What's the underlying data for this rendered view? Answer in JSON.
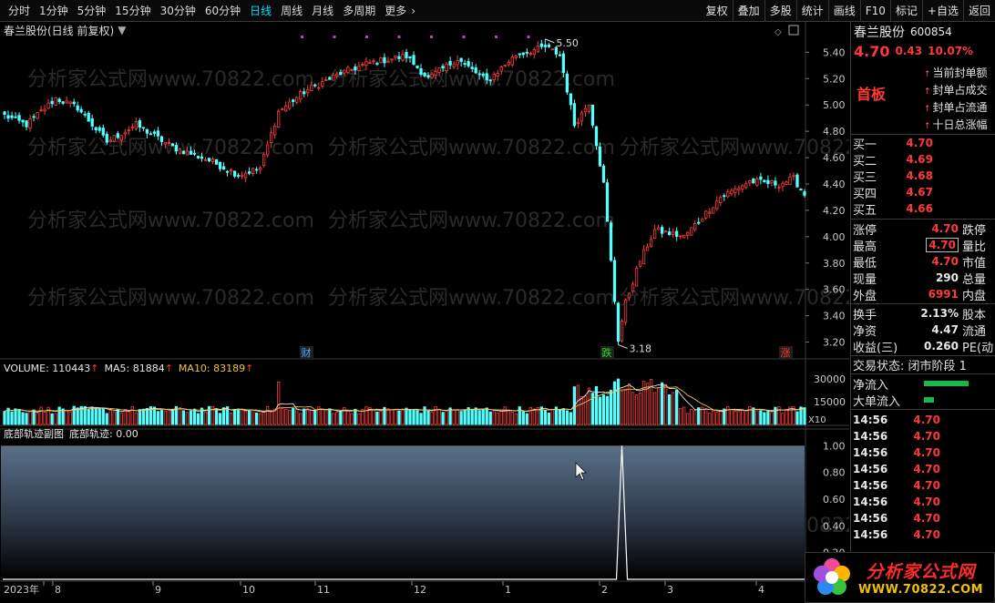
{
  "toolbar": {
    "periods": [
      "分时",
      "1分钟",
      "5分钟",
      "15分钟",
      "30分钟",
      "60分钟",
      "日线",
      "周线",
      "月线",
      "多周期",
      "更多"
    ],
    "active_period": "日线",
    "buttons": [
      "复权",
      "叠加",
      "多股",
      "统计",
      "画线",
      "F10",
      "标记",
      "+自选",
      "返回"
    ]
  },
  "main_chart": {
    "title": "春兰股份(日线 前复权)",
    "high_label": "5.50",
    "low_label": "3.18",
    "markers": [
      {
        "text": "财",
        "color": "#4aa8ff"
      },
      {
        "text": "跌",
        "color": "#20e020"
      },
      {
        "text": "涨",
        "color": "#ff3030"
      }
    ]
  },
  "volume": {
    "label": "VOLUME: 110443",
    "ma5": "MA5: 81884",
    "ma10": "MA10: 83189",
    "ma5_color": "#e8e8e8",
    "ma10_color": "#f0c040",
    "y_labels": [
      "30000",
      "15000"
    ],
    "unit": "X10"
  },
  "sub_chart": {
    "title": "底部轨迹副图",
    "value_label": "底部轨迹: 0.00",
    "y_labels": [
      "1.00",
      "0.80",
      "0.60",
      "0.40",
      "0.20"
    ]
  },
  "x_axis": [
    "2023年",
    "8",
    "9",
    "10",
    "11",
    "12",
    "1",
    "2",
    "3",
    "4"
  ],
  "chart_data": {
    "type": "candlestick",
    "price_ylim": [
      3.1,
      5.52
    ],
    "price_ticks": [
      5.4,
      5.2,
      5.0,
      4.8,
      4.6,
      4.4,
      4.2,
      4.0,
      3.8,
      3.6,
      3.4,
      3.2
    ],
    "colors": {
      "up": "#ff3c3c",
      "down": "#54ffff"
    },
    "anchors": [
      [
        0,
        4.92
      ],
      [
        6,
        4.85
      ],
      [
        14,
        5.05
      ],
      [
        20,
        4.98
      ],
      [
        28,
        4.72
      ],
      [
        36,
        4.85
      ],
      [
        46,
        4.68
      ],
      [
        56,
        4.58
      ],
      [
        64,
        4.47
      ],
      [
        70,
        4.52
      ],
      [
        75,
        4.95
      ],
      [
        82,
        5.1
      ],
      [
        92,
        5.24
      ],
      [
        100,
        5.32
      ],
      [
        110,
        5.37
      ],
      [
        116,
        5.2
      ],
      [
        124,
        5.35
      ],
      [
        132,
        5.18
      ],
      [
        140,
        5.38
      ],
      [
        148,
        5.44
      ],
      [
        152,
        5.38
      ],
      [
        156,
        4.85
      ],
      [
        160,
        5.02
      ],
      [
        164,
        4.4
      ],
      [
        168,
        3.22
      ],
      [
        170,
        3.5
      ],
      [
        174,
        3.82
      ],
      [
        178,
        4.05
      ],
      [
        186,
        4.0
      ],
      [
        196,
        4.3
      ],
      [
        204,
        4.42
      ],
      [
        212,
        4.4
      ],
      [
        216,
        4.44
      ],
      [
        219,
        4.32
      ]
    ],
    "volume_ylim": [
      0,
      36000
    ],
    "volume_ticks": [
      30000,
      15000
    ],
    "sub_ylim": [
      0,
      1.05
    ],
    "sub_ticks": [
      1.0,
      0.8,
      0.6,
      0.4,
      0.2
    ],
    "sub_spike_at": 169
  },
  "quote": {
    "name": "春兰股份",
    "code": "600854",
    "price": "4.70",
    "change": "0.43",
    "pct": "10.07%",
    "first_board": "首板",
    "seal_items": [
      "当前封单额",
      "封单占成交",
      "封单占流通",
      "十日总涨幅"
    ],
    "bids": [
      {
        "label": "买一",
        "price": "4.70"
      },
      {
        "label": "买二",
        "price": "4.69"
      },
      {
        "label": "买三",
        "price": "4.68"
      },
      {
        "label": "买四",
        "price": "4.67"
      },
      {
        "label": "买五",
        "price": "4.66"
      }
    ],
    "stats1": [
      {
        "label": "涨停",
        "value": "4.70",
        "label2": "跌停"
      },
      {
        "label": "最高",
        "value": "4.70",
        "label2": "量比"
      },
      {
        "label": "最低",
        "value": "4.70",
        "label2": "市值"
      },
      {
        "label": "现量",
        "value": "290",
        "label2": "总量"
      },
      {
        "label": "外盘",
        "value": "6991",
        "label2": "内盘"
      }
    ],
    "stats2": [
      {
        "label": "换手",
        "value": "2.13%",
        "label2": "股本"
      },
      {
        "label": "净资",
        "value": "4.47",
        "label2": "流通"
      },
      {
        "label": "收益(三)",
        "value": "0.260",
        "label2": "PE(动"
      }
    ],
    "trade_state": "交易状态: 闭市阶段 1",
    "flows": [
      {
        "label": "净流入",
        "fill": 0.9
      },
      {
        "label": "大单流入",
        "fill": 0.2
      }
    ],
    "ticks": [
      {
        "time": "14:56",
        "price": "4.70"
      },
      {
        "time": "14:56",
        "price": "4.70"
      },
      {
        "time": "14:56",
        "price": "4.70"
      },
      {
        "time": "14:56",
        "price": "4.70"
      },
      {
        "time": "14:56",
        "price": "4.70"
      },
      {
        "time": "14:56",
        "price": "4.70"
      },
      {
        "time": "14:56",
        "price": "4.70"
      },
      {
        "time": "14:56",
        "price": "4.70"
      }
    ]
  },
  "watermark": "分析家公式网www.70822.com",
  "logo": {
    "name": "分析家公式网",
    "url": "WWW.70822.COM"
  }
}
